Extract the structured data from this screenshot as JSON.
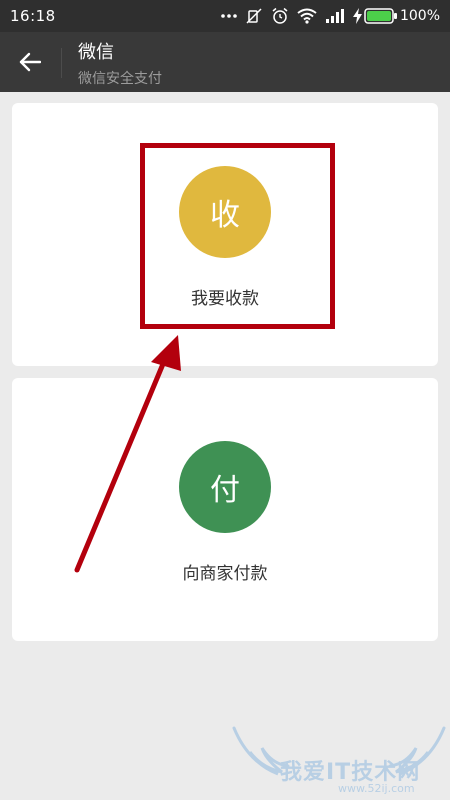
{
  "status_bar": {
    "time": "16:18",
    "battery_percent": "100%",
    "icons": [
      "more-dots-icon",
      "mute-icon",
      "alarm-icon",
      "wifi-icon",
      "signal-icon",
      "charging-icon",
      "battery-icon"
    ]
  },
  "header": {
    "title": "微信",
    "subtitle": "微信安全支付",
    "back_icon": "arrow-left-icon"
  },
  "cards": {
    "receive": {
      "icon_glyph": "收",
      "label": "我要收款",
      "color": "#e0b83e"
    },
    "pay": {
      "icon_glyph": "付",
      "label": "向商家付款",
      "color": "#3f9154"
    }
  },
  "annotation": {
    "color": "#b3000d"
  },
  "watermark": {
    "text": "我爱IT技术网",
    "url": "www.52ij.com"
  },
  "colors": {
    "status_bar_bg": "#2f2f2f",
    "title_bar_bg": "#393939",
    "page_bg": "#ebebeb",
    "card_bg": "#ffffff"
  }
}
